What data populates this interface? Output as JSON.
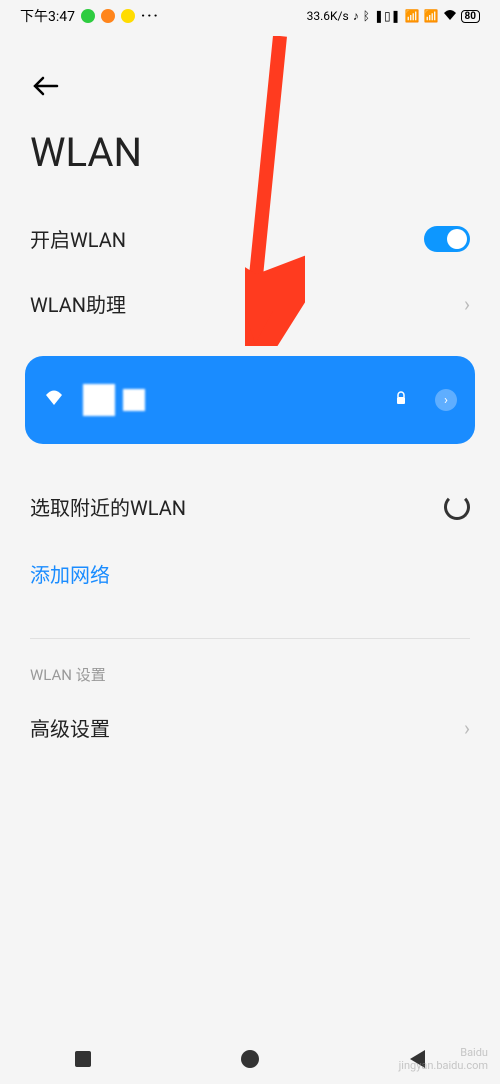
{
  "status_bar": {
    "time": "下午3:47",
    "net_speed": "33.6K/s",
    "battery": "80",
    "more_dots": "···"
  },
  "page": {
    "title": "WLAN"
  },
  "wlan": {
    "enable_label": "开启WLAN",
    "assistant_label": "WLAN助理",
    "nearby_label": "选取附近的WLAN",
    "add_network_label": "添加网络",
    "settings_section": "WLAN 设置",
    "advanced_label": "高级设置"
  },
  "colors": {
    "accent": "#1a8cff",
    "arrow": "#ff3b1f"
  }
}
